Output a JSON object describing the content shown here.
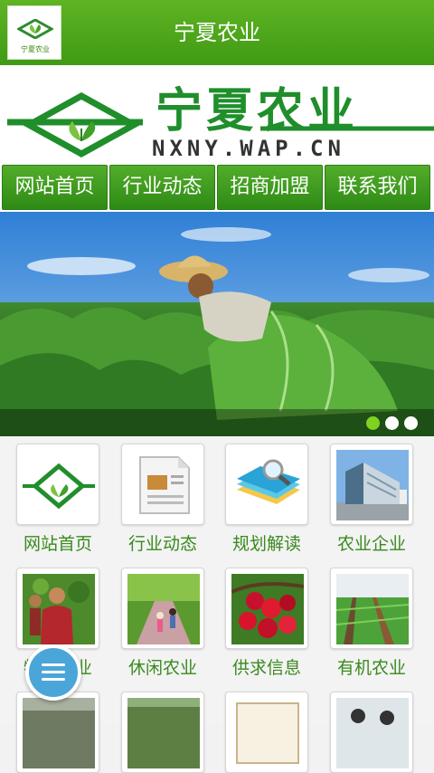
{
  "header": {
    "title": "宁夏农业",
    "logo_text": "宁夏农业"
  },
  "banner": {
    "brand_name": "宁夏农业",
    "url": "NXNY.WAP.CN"
  },
  "nav": {
    "items": [
      {
        "label": "网站首页"
      },
      {
        "label": "行业动态"
      },
      {
        "label": "招商加盟"
      },
      {
        "label": "联系我们"
      }
    ]
  },
  "slider": {
    "active_index": 0,
    "dot_count": 3,
    "active_color": "#7ed321",
    "inactive_color": "#ffffff"
  },
  "grid": {
    "items": [
      {
        "label": "网站首页",
        "icon": "logo-icon"
      },
      {
        "label": "行业动态",
        "icon": "news-document-icon"
      },
      {
        "label": "规划解读",
        "icon": "books-magnifier-icon"
      },
      {
        "label": "农业企业",
        "icon": "building-icon"
      },
      {
        "label": "特色农业",
        "icon": "farmer-icon"
      },
      {
        "label": "休闲农业",
        "icon": "garden-path-icon"
      },
      {
        "label": "供求信息",
        "icon": "cherries-icon"
      },
      {
        "label": "有机农业",
        "icon": "field-rows-icon"
      }
    ]
  },
  "colors": {
    "brand_green": "#3f9a14",
    "label_green": "#3a8a1e",
    "fab_blue": "#4aa6d9"
  }
}
